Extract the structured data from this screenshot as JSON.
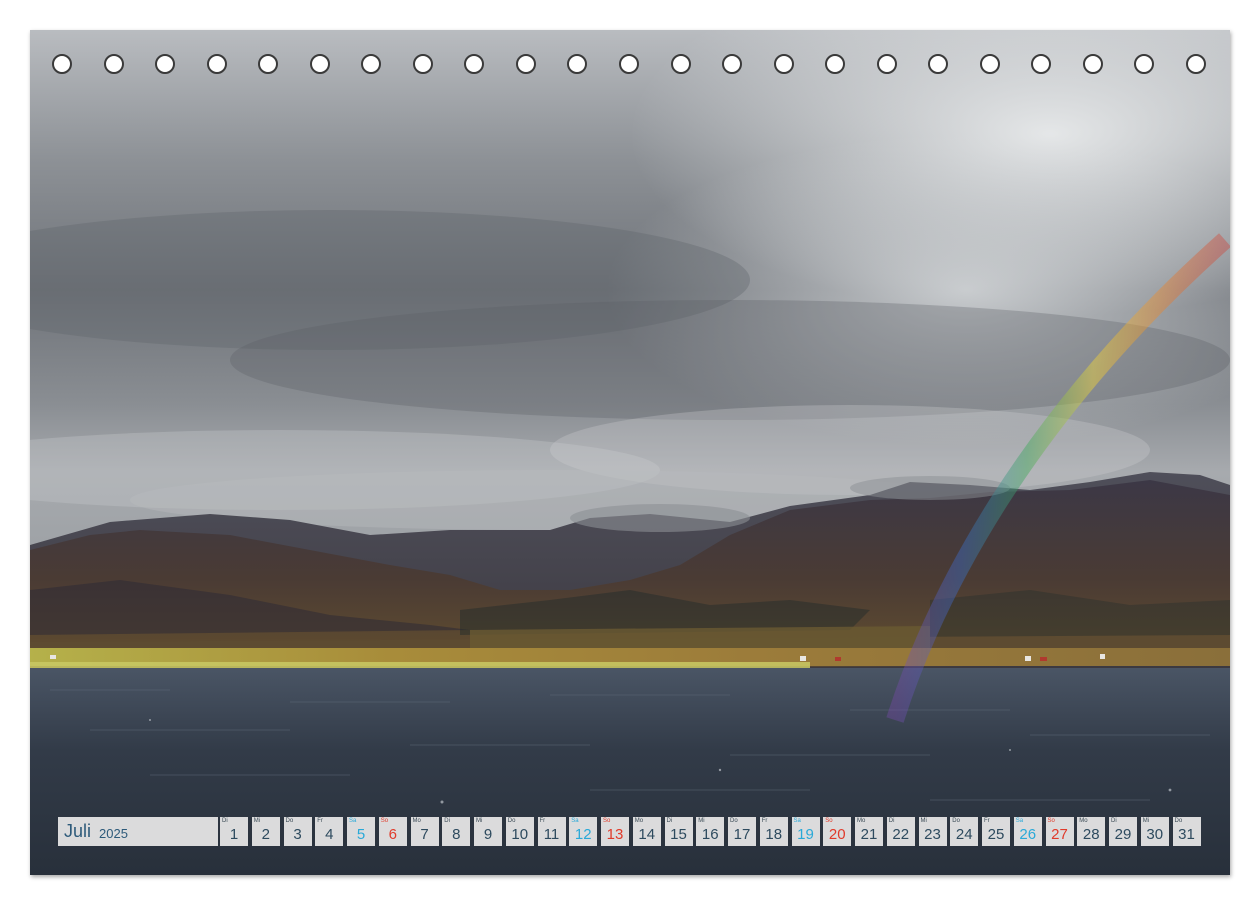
{
  "calendar": {
    "month": "Juli",
    "year": "2025",
    "days": [
      {
        "wd": "Di",
        "num": "1",
        "type": "weekday"
      },
      {
        "wd": "Mi",
        "num": "2",
        "type": "weekday"
      },
      {
        "wd": "Do",
        "num": "3",
        "type": "weekday"
      },
      {
        "wd": "Fr",
        "num": "4",
        "type": "weekday"
      },
      {
        "wd": "Sa",
        "num": "5",
        "type": "sat"
      },
      {
        "wd": "So",
        "num": "6",
        "type": "sun"
      },
      {
        "wd": "Mo",
        "num": "7",
        "type": "weekday"
      },
      {
        "wd": "Di",
        "num": "8",
        "type": "weekday"
      },
      {
        "wd": "Mi",
        "num": "9",
        "type": "weekday"
      },
      {
        "wd": "Do",
        "num": "10",
        "type": "weekday"
      },
      {
        "wd": "Fr",
        "num": "11",
        "type": "weekday"
      },
      {
        "wd": "Sa",
        "num": "12",
        "type": "sat"
      },
      {
        "wd": "So",
        "num": "13",
        "type": "sun"
      },
      {
        "wd": "Mo",
        "num": "14",
        "type": "weekday"
      },
      {
        "wd": "Di",
        "num": "15",
        "type": "weekday"
      },
      {
        "wd": "Mi",
        "num": "16",
        "type": "weekday"
      },
      {
        "wd": "Do",
        "num": "17",
        "type": "weekday"
      },
      {
        "wd": "Fr",
        "num": "18",
        "type": "weekday"
      },
      {
        "wd": "Sa",
        "num": "19",
        "type": "sat"
      },
      {
        "wd": "So",
        "num": "20",
        "type": "sun"
      },
      {
        "wd": "Mo",
        "num": "21",
        "type": "weekday"
      },
      {
        "wd": "Di",
        "num": "22",
        "type": "weekday"
      },
      {
        "wd": "Mi",
        "num": "23",
        "type": "weekday"
      },
      {
        "wd": "Do",
        "num": "24",
        "type": "weekday"
      },
      {
        "wd": "Fr",
        "num": "25",
        "type": "weekday"
      },
      {
        "wd": "Sa",
        "num": "26",
        "type": "sat"
      },
      {
        "wd": "So",
        "num": "27",
        "type": "sun"
      },
      {
        "wd": "Mo",
        "num": "28",
        "type": "weekday"
      },
      {
        "wd": "Di",
        "num": "29",
        "type": "weekday"
      },
      {
        "wd": "Mi",
        "num": "30",
        "type": "weekday"
      },
      {
        "wd": "Do",
        "num": "31",
        "type": "weekday"
      }
    ]
  },
  "binding_holes": 23,
  "colors": {
    "weekday": "#2d4a5e",
    "saturday": "#29a9d8",
    "sunday": "#e03a2a",
    "month_label": "#2d5a7a",
    "cell_background": "#e8e8e8"
  },
  "scene": {
    "icon": "landscape-photo",
    "elements": [
      "cloudy sky",
      "mountains",
      "rainbow",
      "shoreline",
      "fjord water"
    ]
  }
}
